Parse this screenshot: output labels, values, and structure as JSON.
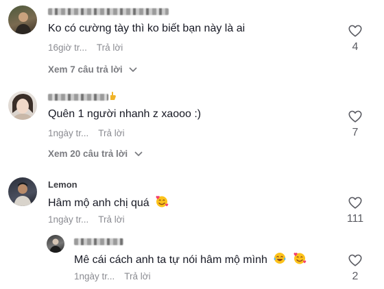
{
  "comments": [
    {
      "username_blurred": true,
      "text": "Ko có cường tày thì ko biết bạn này là ai",
      "time": "16giờ tr...",
      "reply_label": "Trả lời",
      "view_replies": "Xem 7 câu trả lời",
      "likes": "4"
    },
    {
      "username_blurred": true,
      "text": "Quên 1 người nhanh z xaooo :)",
      "time": "1ngày tr...",
      "reply_label": "Trả lời",
      "view_replies": "Xem 20 câu trả lời",
      "likes": "7"
    },
    {
      "username": "Lemon",
      "text": "Hâm mộ anh chị quá",
      "time": "1ngày tr...",
      "reply_label": "Trả lời",
      "likes": "111",
      "emojis": [
        "smiling-face-with-hearts"
      ]
    }
  ],
  "reply": {
    "username_blurred": true,
    "text": "Mê cái cách anh ta tự nói hâm mộ mình",
    "time": "1ngày tr...",
    "reply_label": "Trả lời",
    "likes": "2",
    "emojis": [
      "face-with-tears-of-joy",
      "smiling-face-with-hearts"
    ]
  },
  "icons": {
    "like": "heart-outline-icon",
    "expand": "chevron-down-icon"
  },
  "colors": {
    "text": "#161823",
    "meta": "#8a8b91",
    "icon": "#5b5c63"
  }
}
